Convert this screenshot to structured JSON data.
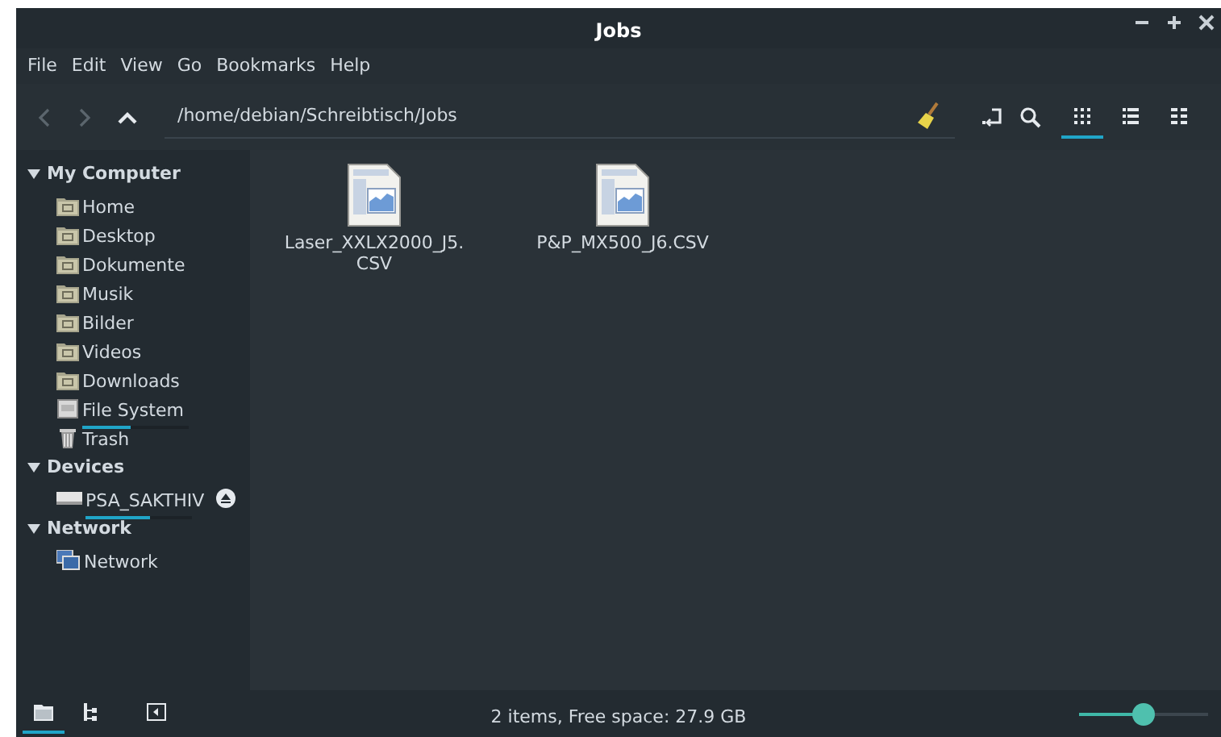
{
  "window": {
    "title": "Jobs"
  },
  "menu": [
    "File",
    "Edit",
    "View",
    "Go",
    "Bookmarks",
    "Help"
  ],
  "location": {
    "value": "/home/debian/Schreibtisch/Jobs"
  },
  "view_buttons": [
    {
      "kind": "icons",
      "selected": true
    },
    {
      "kind": "list",
      "selected": false
    },
    {
      "kind": "compact",
      "selected": false
    }
  ],
  "sidebar": {
    "sections": [
      {
        "title": "My Computer",
        "expanded": true,
        "items": [
          {
            "label": "Home",
            "kind": "folder"
          },
          {
            "label": "Desktop",
            "kind": "folder"
          },
          {
            "label": "Dokumente",
            "kind": "folder"
          },
          {
            "label": "Musik",
            "kind": "folder"
          },
          {
            "label": "Bilder",
            "kind": "folder"
          },
          {
            "label": "Videos",
            "kind": "folder"
          },
          {
            "label": "Downloads",
            "kind": "folder"
          },
          {
            "label": "File System",
            "kind": "drive",
            "level": 0.45
          },
          {
            "label": "Trash",
            "kind": "trash"
          }
        ]
      },
      {
        "title": "Devices",
        "expanded": true,
        "items": [
          {
            "label": "PSA_SAKTHIV",
            "kind": "removable",
            "level": 0.6,
            "ejectable": true
          }
        ]
      },
      {
        "title": "Network",
        "expanded": true,
        "items": [
          {
            "label": "Network",
            "kind": "network"
          }
        ]
      }
    ]
  },
  "files": [
    {
      "name": "Laser_XXLX2000_J5.\nCSV"
    },
    {
      "name": "P&P_MX500_J6.CSV"
    }
  ],
  "status_bar": {
    "panes": [
      {
        "kind": "places",
        "selected": true
      },
      {
        "kind": "tree",
        "selected": false
      },
      {
        "kind": "hide",
        "selected": false
      }
    ],
    "text": "2 items, Free space: 27.9 GB",
    "zoom": {
      "level": 0.5
    }
  }
}
